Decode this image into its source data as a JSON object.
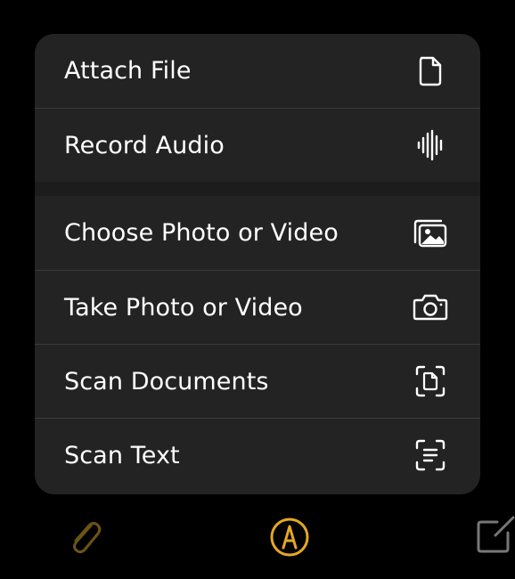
{
  "menu": {
    "groups": [
      {
        "items": [
          {
            "label": "Attach File",
            "icon": "document-icon"
          },
          {
            "label": "Record Audio",
            "icon": "waveform-icon"
          }
        ]
      },
      {
        "items": [
          {
            "label": "Choose Photo or Video",
            "icon": "photo-library-icon"
          },
          {
            "label": "Take Photo or Video",
            "icon": "camera-icon"
          },
          {
            "label": "Scan Documents",
            "icon": "document-scanner-icon"
          },
          {
            "label": "Scan Text",
            "icon": "text-scanner-icon"
          }
        ]
      }
    ]
  },
  "toolbar": {
    "items": [
      {
        "icon": "paperclip-icon",
        "state": "dimmed"
      },
      {
        "icon": "markup-pen-icon",
        "state": "active"
      },
      {
        "icon": "compose-icon",
        "state": "dimmed"
      }
    ]
  },
  "colors": {
    "background": "#000000",
    "menu_background": "#232323",
    "separator": "#3b3b3b",
    "group_gap": "#1c1c1c",
    "text": "#ffffff",
    "accent": "#e5a823",
    "accent_dimmed": "#6b5414",
    "toolbar_dimmed_gray": "#777777"
  }
}
